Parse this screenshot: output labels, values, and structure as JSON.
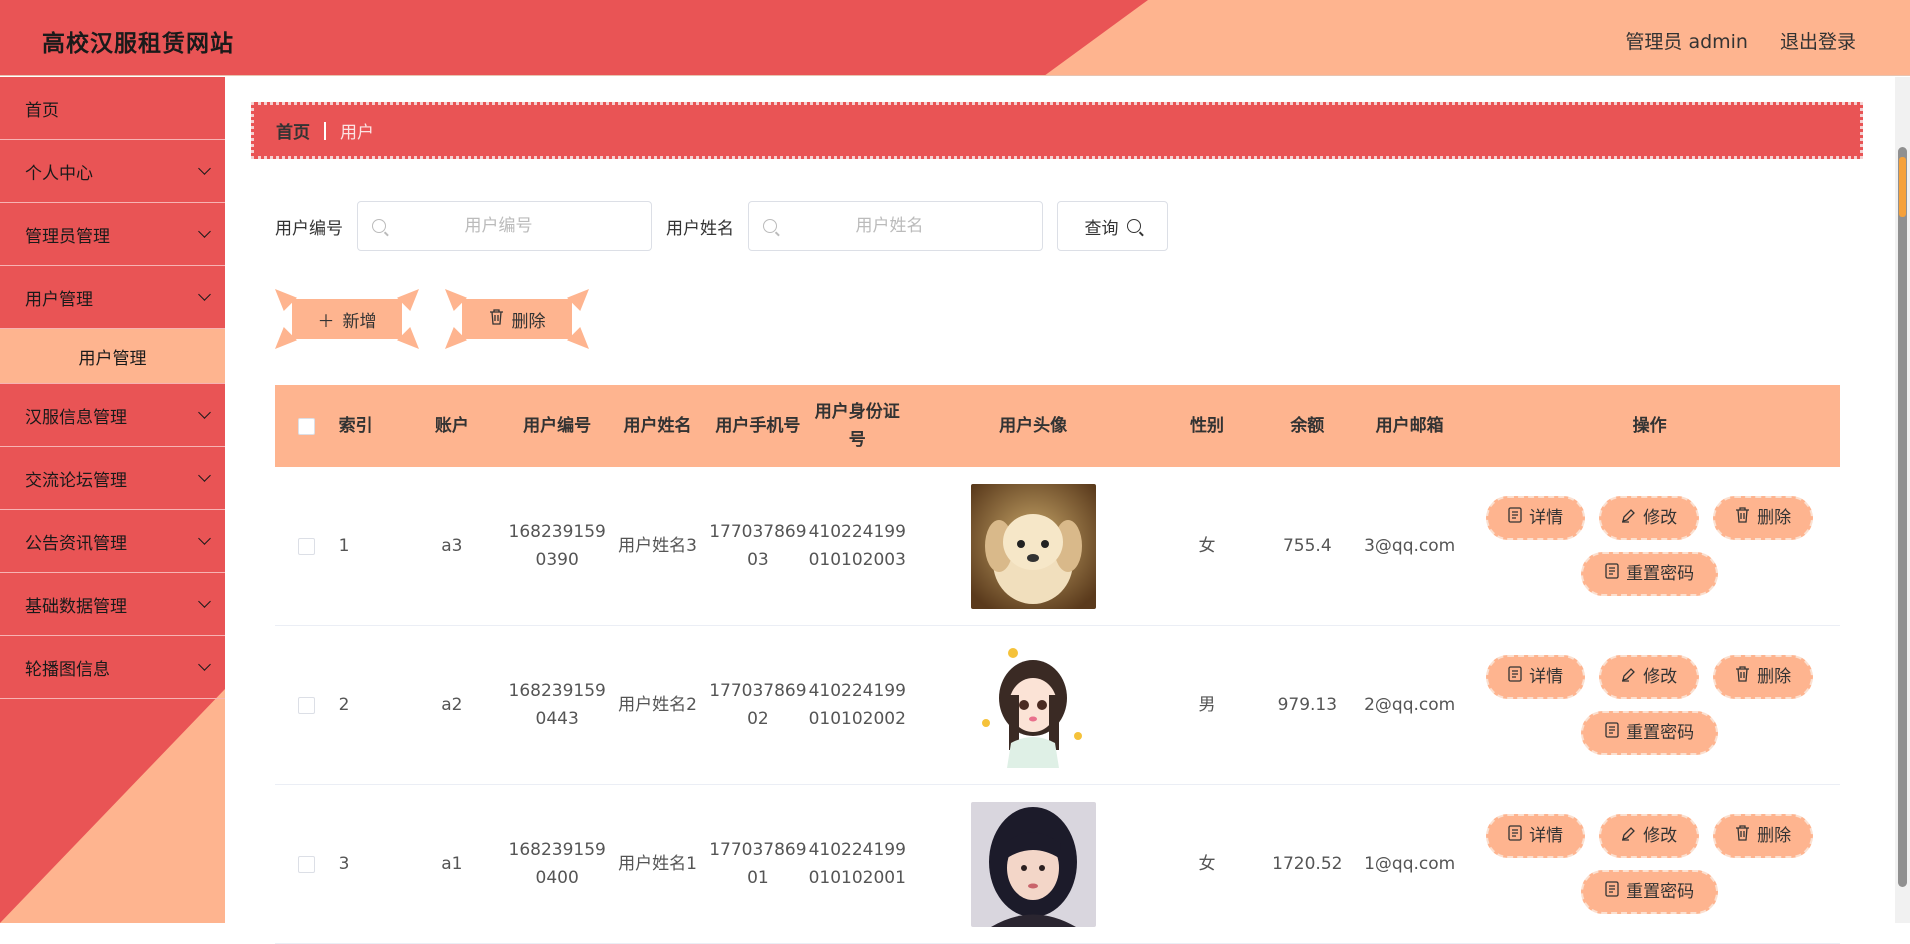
{
  "header": {
    "title": "高校汉服租赁网站",
    "user_label": "管理员 admin",
    "logout_label": "退出登录"
  },
  "sidebar": {
    "items": [
      {
        "label": "首页",
        "expandable": false
      },
      {
        "label": "个人中心",
        "expandable": true
      },
      {
        "label": "管理员管理",
        "expandable": true
      },
      {
        "label": "用户管理",
        "expandable": true
      },
      {
        "label": "用户管理",
        "sub": true
      },
      {
        "label": "汉服信息管理",
        "expandable": true
      },
      {
        "label": "交流论坛管理",
        "expandable": true
      },
      {
        "label": "公告资讯管理",
        "expandable": true
      },
      {
        "label": "基础数据管理",
        "expandable": true
      },
      {
        "label": "轮播图信息",
        "expandable": true
      }
    ]
  },
  "breadcrumb": {
    "home": "首页",
    "current": "用户"
  },
  "search": {
    "user_no_label": "用户编号",
    "user_no_placeholder": "用户编号",
    "user_no_value": "",
    "user_name_label": "用户姓名",
    "user_name_placeholder": "用户姓名",
    "user_name_value": "",
    "query_label": "查询"
  },
  "actions": {
    "add_label": "新增",
    "delete_label": "删除"
  },
  "table": {
    "headers": {
      "index": "索引",
      "account": "账户",
      "user_no": "用户编号",
      "user_name": "用户姓名",
      "phone": "用户手机号",
      "id_card": "用户身份证号",
      "avatar": "用户头像",
      "gender": "性别",
      "balance": "余额",
      "email": "用户邮箱",
      "ops": "操作"
    },
    "rows": [
      {
        "index": "1",
        "account": "a3",
        "user_no": "1682391590390",
        "user_name": "用户姓名3",
        "phone": "17703786903",
        "id_card": "410224199010102003",
        "gender": "女",
        "balance": "755.4",
        "email": "3@qq.com"
      },
      {
        "index": "2",
        "account": "a2",
        "user_no": "1682391590443",
        "user_name": "用户姓名2",
        "phone": "17703786902",
        "id_card": "410224199010102002",
        "gender": "男",
        "balance": "979.13",
        "email": "2@qq.com"
      },
      {
        "index": "3",
        "account": "a1",
        "user_no": "1682391590400",
        "user_name": "用户姓名1",
        "phone": "17703786901",
        "id_card": "410224199010102001",
        "gender": "女",
        "balance": "1720.52",
        "email": "1@qq.com"
      }
    ],
    "ops": {
      "detail": "详情",
      "edit": "修改",
      "delete": "删除",
      "reset": "重置密码"
    }
  },
  "colors": {
    "primary_red": "#e95455",
    "peach": "#feb48f"
  }
}
